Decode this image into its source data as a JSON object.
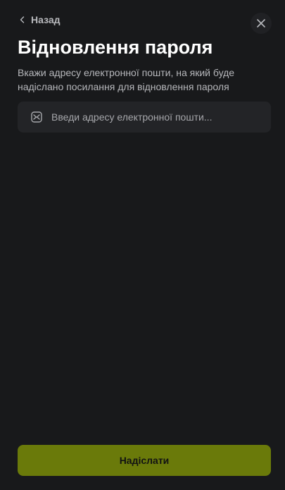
{
  "nav": {
    "back_label": "Назад",
    "back_icon": "chevron-left-icon",
    "close_icon": "close-icon"
  },
  "header": {
    "title": "Відновлення пароля",
    "subtitle": "Вкажи адресу електронної пошти, на який буде надіслано посилання для відновлення пароля"
  },
  "form": {
    "email": {
      "icon": "mail-icon",
      "value": "",
      "placeholder": "Введи адресу електронної пошти..."
    },
    "submit_label": "Надіслати"
  },
  "colors": {
    "background": "#18191b",
    "field_background": "#232427",
    "accent": "#6a7a0a",
    "muted_text": "#b6b7bb"
  }
}
